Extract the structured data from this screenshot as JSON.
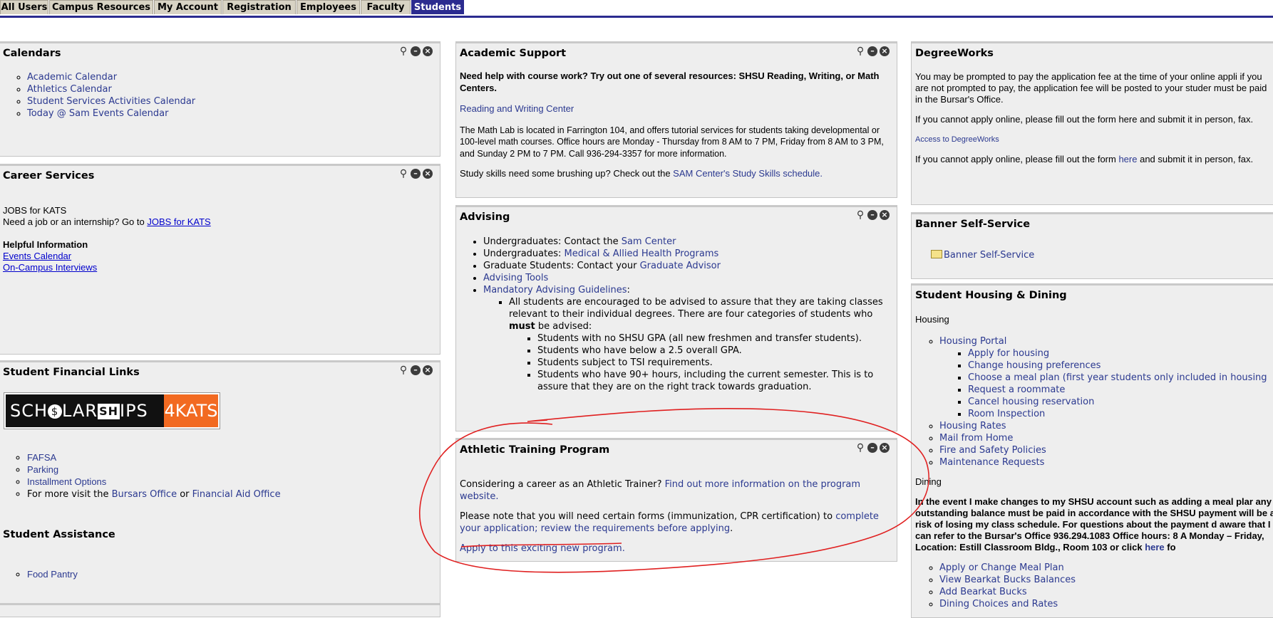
{
  "tabs": [
    {
      "label": "All Users"
    },
    {
      "label": "Campus Resources"
    },
    {
      "label": "My Account"
    },
    {
      "label": "Registration"
    },
    {
      "label": "Employees"
    },
    {
      "label": "Faculty"
    },
    {
      "label": "Students",
      "active": true
    }
  ],
  "calendars": {
    "title": "Calendars",
    "items": [
      "Academic Calendar",
      "Athletics Calendar",
      "Student Services Activities Calendar",
      "Today @ Sam Events Calendar"
    ]
  },
  "career": {
    "title": "Career Services",
    "jobs_heading": "JOBS for KATS",
    "jobs_text": "Need a job or an internship? Go to ",
    "jobs_link": "JOBS for KATS",
    "helpful_heading": "Helpful Information",
    "links": [
      "Events Calendar",
      "On-Campus Interviews"
    ]
  },
  "financial": {
    "title": "Student Financial Links",
    "banner_left": "SCH",
    "banner_dollar": "$",
    "banner_mid": "LAR",
    "banner_sh": "SH",
    "banner_ips": "IPS",
    "banner_right": "4KATS",
    "items": [
      "FAFSA",
      "Parking",
      "Installment Options"
    ],
    "more_text": "For more visit the ",
    "bursar_link": "Bursars Office",
    "or_text": " or ",
    "aid_link": "Financial Aid Office"
  },
  "assistance": {
    "title": "Student Assistance",
    "items": [
      "Food Pantry"
    ]
  },
  "academic": {
    "title": "Academic Support",
    "intro": "Need help with course work?  Try out one of several resources: SHSU Reading, Writing, or Math Centers.",
    "rw_link": "Reading and Writing Center",
    "math_text": "The Math Lab is located in Farrington 104, and offers tutorial services for students taking developmental or 100-level math courses.  Office hours are Monday - Thursday from 8 AM to 7 PM, Friday from 8 AM to 3 PM, and Sunday 2 PM to 7 PM.  Call 936-294-3357 for more information.",
    "study_text": "Study skills need some brushing up? Check out the ",
    "study_link": "SAM Center's Study Skills schedule."
  },
  "advising": {
    "title": "Advising",
    "ug_text": "Undergraduates: Contact the ",
    "ug_link": "Sam Center",
    "ug2_text": "Undergraduates: ",
    "ug2_link": "Medical & Allied Health Programs",
    "grad_text": "Graduate Students: Contact your ",
    "grad_link": "Graduate Advisor",
    "tools_link": "Advising Tools",
    "mand_link": "Mandatory Advising Guidelines",
    "mand_colon": ":",
    "all_text_1": "All students are encouraged to be advised to assure that they are taking classes relevant to their individual degrees. There are four categories of students who ",
    "all_bold": "must",
    "all_text_2": " be advised:",
    "categories": [
      "Students with no SHSU GPA (all new freshmen and transfer students).",
      "Students who have below a 2.5 overall GPA.",
      "Students subject to TSI requirements.",
      "Students who have 90+ hours, including the current semester. This is to assure that they are on the right track towards graduation."
    ]
  },
  "athletic": {
    "title": "Athletic Training Program",
    "consider_text": "Considering a career as an Athletic Trainer? ",
    "consider_link": "Find out more information on the program website.",
    "note_text": "Please note that you will need certain forms (immunization, CPR certification) to ",
    "note_link": "complete your application; review the requirements before applying",
    "note_end": ".",
    "apply_link": "Apply to this exciting new program."
  },
  "degreeworks": {
    "title": "DegreeWorks",
    "p1": "You may be prompted to pay the application fee at the time of your online appli if you are not prompted to pay, the application fee will be posted to your studer must be paid in the Bursar's Office.",
    "p2": "If you cannot apply online, please fill out the form here and submit it in person, fax.",
    "access_link": "Access to DegreeWorks",
    "p3_a": "If you cannot apply online, please fill out the form ",
    "p3_link": "here",
    "p3_b": " and submit it in person, fax."
  },
  "banner": {
    "title": "Banner Self-Service",
    "link": "Banner Self-Service"
  },
  "housing": {
    "title": "Student Housing & Dining",
    "housing_label": "Housing",
    "portal": "Housing Portal",
    "portal_items": [
      "Apply for housing",
      "Change housing preferences",
      "Choose a meal plan (first year students only included in housing",
      "Request a roommate",
      "Cancel housing reservation",
      "Room Inspection"
    ],
    "other_items": [
      "Housing Rates",
      "Mail from Home",
      "Fire and Safety Policies",
      "Maintenance Requests"
    ],
    "dining_label": "Dining",
    "dining_text_1": "In the event I make changes to my SHSU account such as adding a meal plar any outstanding balance must be paid in accordance with the SHSU payment will be at risk of losing my class schedule. For questions about the payment d aware that I can refer to the Bursar's Office 936.294.1083 Office hours: 8 A Monday – Friday, Location: Estill Classroom Bldg., Room 103 or click ",
    "dining_link": "here",
    "dining_text_2": " fo",
    "dining_items": [
      "Apply or Change Meal Plan",
      "View Bearkat Bucks Balances",
      "Add Bearkat Bucks",
      "Dining Choices and Rates"
    ]
  },
  "colors": {
    "tab_active": "#2b2b8f",
    "link": "#2b3990",
    "annotation": "#e02020",
    "banner_orange": "#f26a21"
  },
  "icons": [
    "magnifier-icon",
    "minimize-icon",
    "close-icon",
    "folder-icon"
  ]
}
